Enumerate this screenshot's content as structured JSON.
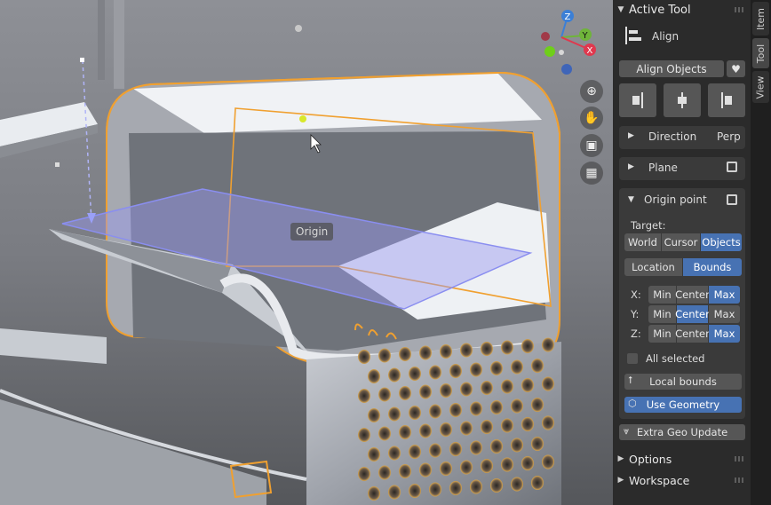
{
  "viewport": {
    "origin_tooltip": "Origin",
    "axes": {
      "z": "Z",
      "y": "Y",
      "x": "X"
    },
    "nav_icons": [
      "zoom-icon",
      "hand-pan-icon",
      "camera-icon",
      "grid-view-icon"
    ]
  },
  "panel": {
    "active_tool_header": "Active Tool",
    "tool_name": "Align",
    "align_objects_label": "Align Objects",
    "direction": {
      "label": "Direction",
      "value": "Perp"
    },
    "plane_label": "Plane",
    "origin_point": {
      "label": "Origin point",
      "target_label": "Target:",
      "target_options": [
        "World",
        "Cursor",
        "Objects"
      ],
      "target_selected": "Objects",
      "mode_options": [
        "Location",
        "Bounds"
      ],
      "mode_selected": "Bounds",
      "axes": [
        {
          "label": "X:",
          "options": [
            "Min",
            "Center",
            "Max"
          ],
          "selected": "Max"
        },
        {
          "label": "Y:",
          "options": [
            "Min",
            "Center",
            "Max"
          ],
          "selected": "Center"
        },
        {
          "label": "Z:",
          "options": [
            "Min",
            "Center",
            "Max"
          ],
          "selected": "Max"
        }
      ],
      "all_selected_label": "All selected",
      "local_bounds_label": "Local bounds",
      "use_geometry_label": "Use Geometry"
    },
    "extra_geo_update_label": "Extra Geo Update",
    "options_header": "Options",
    "workspace_header": "Workspace"
  },
  "tabs": [
    "Item",
    "Tool",
    "View"
  ],
  "active_tab": "Tool",
  "colors": {
    "accent": "#4772b3",
    "selection_outline": "#f0a030",
    "panel_bg": "#2b2b2b"
  }
}
